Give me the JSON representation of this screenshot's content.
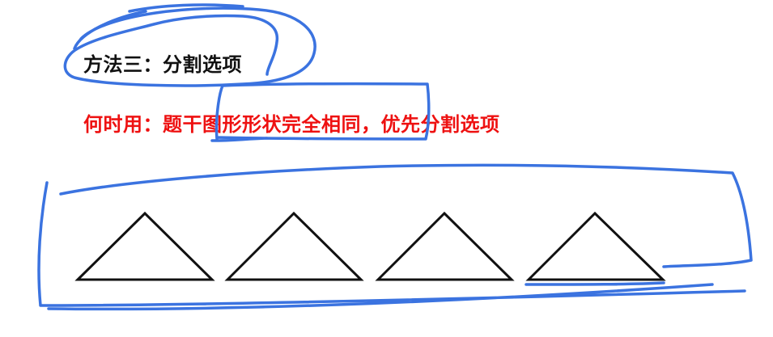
{
  "heading": "方法三：分割选项",
  "subheading": "何时用：题干图形形状完全相同，优先分割选项",
  "colors": {
    "heading": "#111111",
    "subheading": "#ee1111",
    "annotation_ink": "#3b73e0",
    "shape_stroke": "#111111"
  },
  "shapes": {
    "kind": "triangle",
    "count": 4
  }
}
